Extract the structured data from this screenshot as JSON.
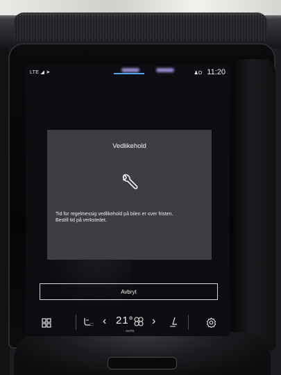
{
  "status_bar": {
    "network": "LTE",
    "alert_icon": "person-icon",
    "alert_value": "O",
    "time": "11:20"
  },
  "dialog": {
    "title": "Vedlikehold",
    "icon": "wrench-icon",
    "message_line1": "Tid for regelmessig vedlikehold på bilen er over fristen.",
    "message_line2": "Bestill tid på verkstedet."
  },
  "actions": {
    "cancel_label": "Avbryt"
  },
  "climate": {
    "temperature": "21°",
    "mode": "AUTO",
    "icons": [
      "apps-icon",
      "seat-heat-icon",
      "fan-icon",
      "seat-icon",
      "settings-icon"
    ]
  },
  "colors": {
    "screen_bg": "#0c0d10",
    "dialog_bg": "#3c3e44",
    "accent": "#4aa6e8",
    "text": "#f2f2f2"
  }
}
